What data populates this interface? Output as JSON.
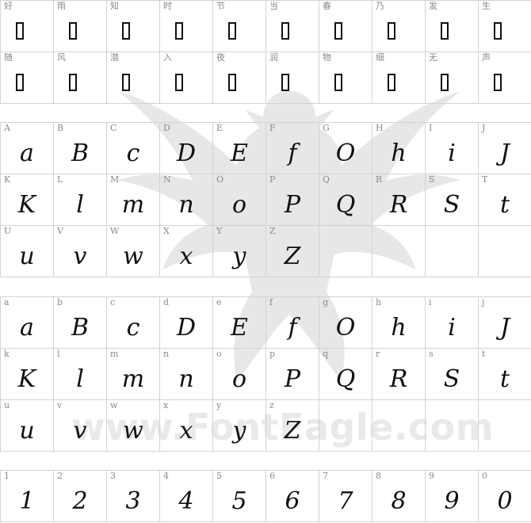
{
  "watermark": {
    "text": "www.FontEagle.com"
  },
  "sections": [
    {
      "id": "cjk",
      "cells": [
        {
          "label": "好",
          "glyph": ""
        },
        {
          "label": "雨",
          "glyph": ""
        },
        {
          "label": "知",
          "glyph": ""
        },
        {
          "label": "时",
          "glyph": ""
        },
        {
          "label": "节",
          "glyph": ""
        },
        {
          "label": "当",
          "glyph": ""
        },
        {
          "label": "春",
          "glyph": ""
        },
        {
          "label": "乃",
          "glyph": ""
        },
        {
          "label": "发",
          "glyph": ""
        },
        {
          "label": "生",
          "glyph": ""
        },
        {
          "label": "随",
          "glyph": ""
        },
        {
          "label": "风",
          "glyph": ""
        },
        {
          "label": "潜",
          "glyph": ""
        },
        {
          "label": "入",
          "glyph": ""
        },
        {
          "label": "夜",
          "glyph": ""
        },
        {
          "label": "润",
          "glyph": ""
        },
        {
          "label": "物",
          "glyph": ""
        },
        {
          "label": "细",
          "glyph": ""
        },
        {
          "label": "无",
          "glyph": ""
        },
        {
          "label": "声",
          "glyph": ""
        }
      ]
    },
    {
      "id": "upper",
      "cells": [
        {
          "label": "A",
          "glyph": "a"
        },
        {
          "label": "B",
          "glyph": "B"
        },
        {
          "label": "C",
          "glyph": "c"
        },
        {
          "label": "D",
          "glyph": "D"
        },
        {
          "label": "E",
          "glyph": "E"
        },
        {
          "label": "F",
          "glyph": "f"
        },
        {
          "label": "G",
          "glyph": "O"
        },
        {
          "label": "H",
          "glyph": "h"
        },
        {
          "label": "I",
          "glyph": "i"
        },
        {
          "label": "J",
          "glyph": "J"
        },
        {
          "label": "K",
          "glyph": "K"
        },
        {
          "label": "L",
          "glyph": "l"
        },
        {
          "label": "M",
          "glyph": "m"
        },
        {
          "label": "N",
          "glyph": "n"
        },
        {
          "label": "O",
          "glyph": "o"
        },
        {
          "label": "P",
          "glyph": "P"
        },
        {
          "label": "Q",
          "glyph": "Q"
        },
        {
          "label": "R",
          "glyph": "R"
        },
        {
          "label": "S",
          "glyph": "S"
        },
        {
          "label": "T",
          "glyph": "t"
        },
        {
          "label": "U",
          "glyph": "u"
        },
        {
          "label": "V",
          "glyph": "v"
        },
        {
          "label": "W",
          "glyph": "w"
        },
        {
          "label": "X",
          "glyph": "x"
        },
        {
          "label": "Y",
          "glyph": "y"
        },
        {
          "label": "Z",
          "glyph": "Z"
        },
        {
          "label": "",
          "glyph": ""
        },
        {
          "label": "",
          "glyph": ""
        },
        {
          "label": "",
          "glyph": ""
        },
        {
          "label": "",
          "glyph": ""
        }
      ]
    },
    {
      "id": "lower",
      "cells": [
        {
          "label": "a",
          "glyph": "a"
        },
        {
          "label": "b",
          "glyph": "B"
        },
        {
          "label": "c",
          "glyph": "c"
        },
        {
          "label": "d",
          "glyph": "D"
        },
        {
          "label": "e",
          "glyph": "E"
        },
        {
          "label": "f",
          "glyph": "f"
        },
        {
          "label": "g",
          "glyph": "O"
        },
        {
          "label": "h",
          "glyph": "h"
        },
        {
          "label": "i",
          "glyph": "i"
        },
        {
          "label": "j",
          "glyph": "J"
        },
        {
          "label": "k",
          "glyph": "K"
        },
        {
          "label": "l",
          "glyph": "l"
        },
        {
          "label": "m",
          "glyph": "m"
        },
        {
          "label": "n",
          "glyph": "n"
        },
        {
          "label": "o",
          "glyph": "o"
        },
        {
          "label": "p",
          "glyph": "P"
        },
        {
          "label": "q",
          "glyph": "Q"
        },
        {
          "label": "r",
          "glyph": "R"
        },
        {
          "label": "s",
          "glyph": "S"
        },
        {
          "label": "t",
          "glyph": "t"
        },
        {
          "label": "u",
          "glyph": "u"
        },
        {
          "label": "v",
          "glyph": "v"
        },
        {
          "label": "w",
          "glyph": "w"
        },
        {
          "label": "x",
          "glyph": "x"
        },
        {
          "label": "y",
          "glyph": "y"
        },
        {
          "label": "z",
          "glyph": "Z"
        },
        {
          "label": "",
          "glyph": ""
        },
        {
          "label": "",
          "glyph": ""
        },
        {
          "label": "",
          "glyph": ""
        },
        {
          "label": "",
          "glyph": ""
        }
      ]
    },
    {
      "id": "digits",
      "cells": [
        {
          "label": "1",
          "glyph": "1"
        },
        {
          "label": "2",
          "glyph": "2"
        },
        {
          "label": "3",
          "glyph": "3"
        },
        {
          "label": "4",
          "glyph": "4"
        },
        {
          "label": "5",
          "glyph": "5"
        },
        {
          "label": "6",
          "glyph": "6"
        },
        {
          "label": "7",
          "glyph": "7"
        },
        {
          "label": "8",
          "glyph": "8"
        },
        {
          "label": "9",
          "glyph": "9"
        },
        {
          "label": "0",
          "glyph": "0"
        }
      ]
    }
  ]
}
